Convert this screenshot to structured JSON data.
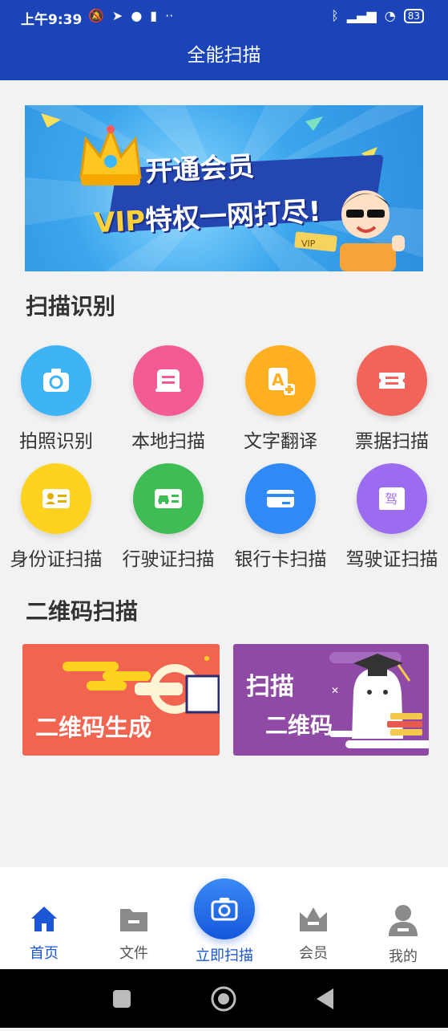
{
  "status_bar": {
    "time": "上午9:39",
    "battery": "83"
  },
  "header": {
    "title": "全能扫描"
  },
  "banner": {
    "line1": "开通会员",
    "line2_vip": "VIP",
    "line2_rest": "特权一网打尽!",
    "card": "VIP"
  },
  "sections": {
    "scan": "扫描识别",
    "qrcode": "二维码扫描"
  },
  "features": [
    {
      "label": "拍照识别",
      "icon": "camera-icon",
      "color": "#3fb4f5"
    },
    {
      "label": "本地扫描",
      "icon": "document-icon",
      "color": "#f25b93"
    },
    {
      "label": "文字翻译",
      "icon": "translate-icon",
      "color": "#ffb020"
    },
    {
      "label": "票据扫描",
      "icon": "ticket-icon",
      "color": "#f2645a"
    },
    {
      "label": "身份证扫描",
      "icon": "id-card-icon",
      "color": "#ffd21f"
    },
    {
      "label": "行驶证扫描",
      "icon": "vehicle-license-icon",
      "color": "#3ebd55"
    },
    {
      "label": "银行卡扫描",
      "icon": "bank-card-icon",
      "color": "#2f8af5"
    },
    {
      "label": "驾驶证扫描",
      "icon": "driver-license-icon",
      "color": "#9b6bf0"
    }
  ],
  "qr_cards": {
    "generate": "二维码生成",
    "scan_line1": "扫描",
    "scan_line2": "二维码"
  },
  "bottom_nav": {
    "home": "首页",
    "files": "文件",
    "scan_now": "立即扫描",
    "member": "会员",
    "mine": "我的"
  }
}
